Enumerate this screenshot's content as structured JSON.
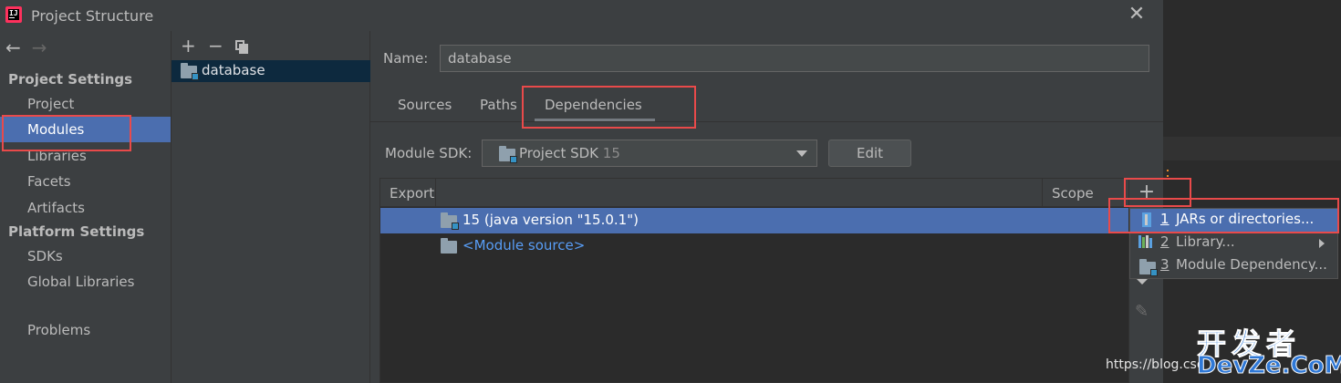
{
  "window": {
    "title": "Project Structure"
  },
  "nav": {
    "section_project": "Project Settings",
    "project_items": [
      {
        "label": "Project"
      },
      {
        "label": "Modules"
      },
      {
        "label": "Libraries"
      },
      {
        "label": "Facets"
      },
      {
        "label": "Artifacts"
      }
    ],
    "section_platform": "Platform Settings",
    "platform_items": [
      {
        "label": "SDKs"
      },
      {
        "label": "Global Libraries"
      }
    ],
    "problems": "Problems"
  },
  "modules": {
    "items": [
      {
        "label": "database"
      }
    ]
  },
  "main": {
    "name_label": "Name:",
    "name_value": "database",
    "tabs": [
      {
        "label": "Sources"
      },
      {
        "label": "Paths"
      },
      {
        "label": "Dependencies"
      }
    ],
    "sdk_label": "Module SDK:",
    "sdk_value": "Project SDK",
    "sdk_version": "15",
    "edit_label": "Edit",
    "table": {
      "col_export": "Export",
      "col_scope": "Scope",
      "rows": [
        {
          "label": "15 (java version \"15.0.1\")"
        },
        {
          "label": "<Module source>"
        }
      ]
    }
  },
  "popup": {
    "items": [
      {
        "num": "1",
        "label": "JARs or directories..."
      },
      {
        "num": "2",
        "label": "Library..."
      },
      {
        "num": "3",
        "label": "Module Dependency..."
      }
    ]
  },
  "watermark": {
    "url": "https://blog.csd",
    "brand": "开发者",
    "brand_sub": "DevZe.CoM"
  },
  "colors": {
    "selection": "#4b6eaf",
    "annotation": "#e94a4a",
    "link": "#589df6"
  }
}
